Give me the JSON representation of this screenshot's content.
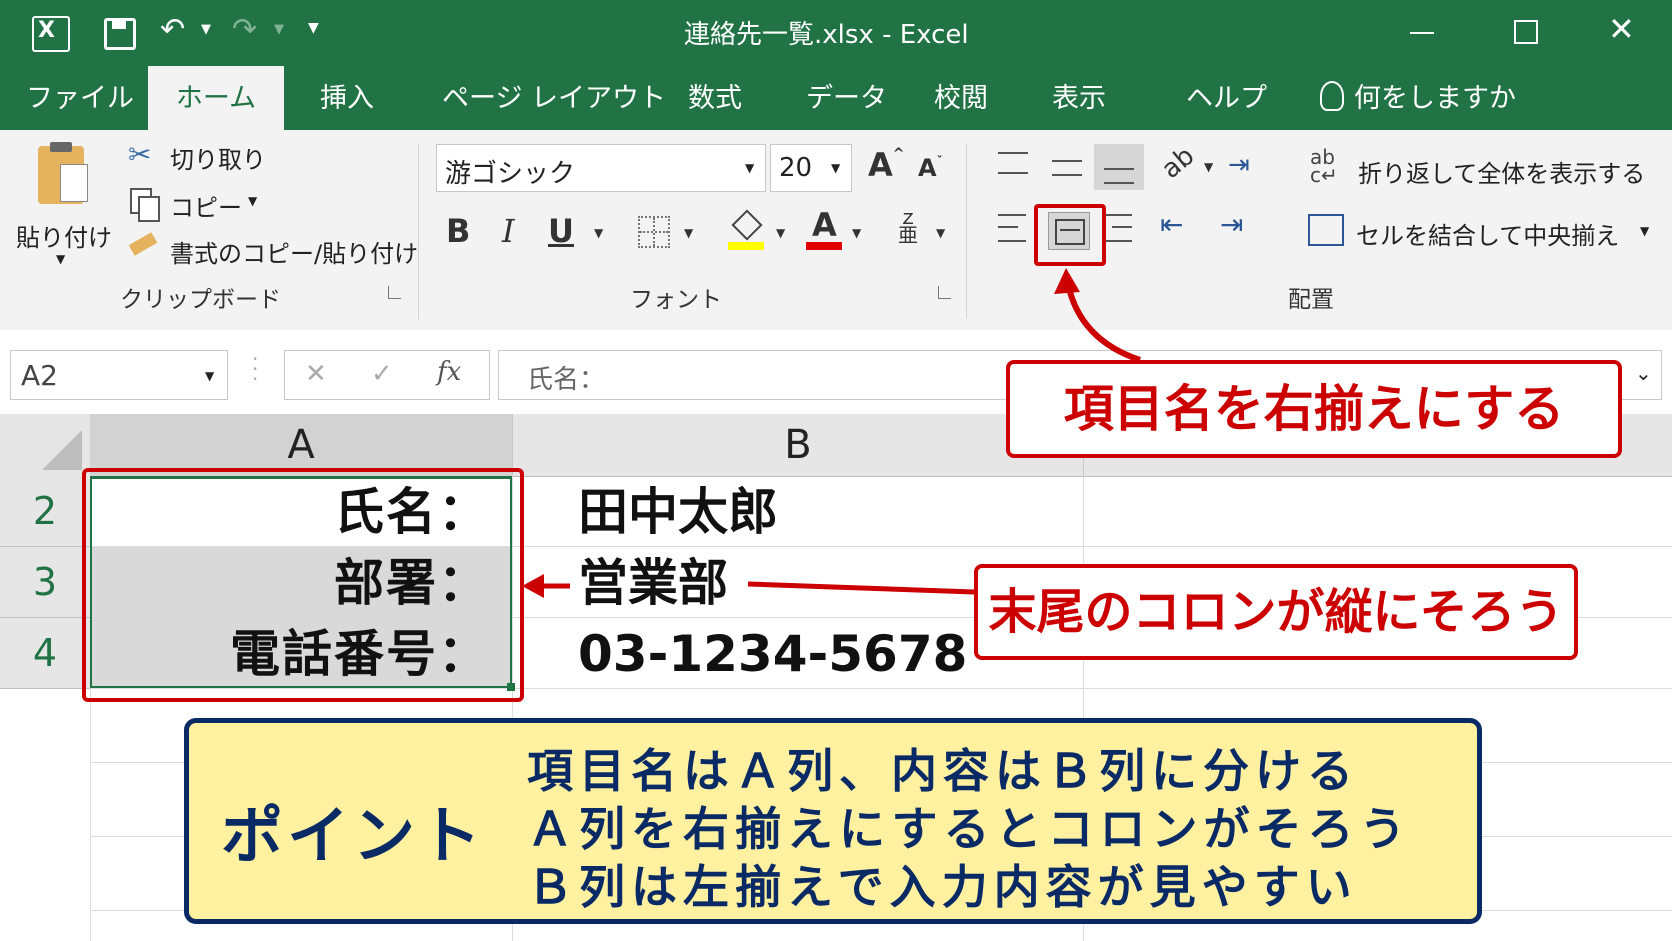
{
  "window": {
    "title": "連絡先一覧.xlsx - Excel"
  },
  "tabs": [
    "ファイル",
    "ホーム",
    "挿入",
    "ページ レイアウト",
    "数式",
    "データ",
    "校閲",
    "表示",
    "ヘルプ"
  ],
  "tell_me": "何をしますか",
  "clipboard": {
    "paste": "貼り付け",
    "cut": "切り取り",
    "copy": "コピー",
    "format_painter": "書式のコピー/貼り付け",
    "group": "クリップボード"
  },
  "font": {
    "name": "游ゴシック",
    "size": "20",
    "bold": "B",
    "italic": "I",
    "underline": "U",
    "font_color": "A",
    "group": "フォント"
  },
  "alignment": {
    "wrap": "折り返して全体を表示する",
    "merge": "セルを結合して中央揃え",
    "group": "配置"
  },
  "formula_bar": {
    "name_box": "A2",
    "fx": "fx",
    "content": "氏名："
  },
  "grid": {
    "col_a": "A",
    "col_b": "B",
    "rows": [
      {
        "num": "2",
        "a": "氏名：",
        "b": "田中太郎"
      },
      {
        "num": "3",
        "a": "部署：",
        "b": "営業部"
      },
      {
        "num": "4",
        "a": "電話番号：",
        "b": "03-1234-5678"
      }
    ]
  },
  "callouts": {
    "right_align": "項目名を右揃えにする",
    "colon": "末尾のコロンが縦にそろう"
  },
  "point": {
    "label": "ポイント",
    "lines": [
      "項目名はＡ列、内容はＢ列に分ける",
      "Ａ列を右揃えにするとコロンがそろう",
      "Ｂ列は左揃えで入力内容が見やすい"
    ]
  },
  "colors": {
    "excel_green": "#217346",
    "callout_red": "#cc0000",
    "point_bg": "#fff1a0",
    "point_border": "#0a2a66"
  }
}
